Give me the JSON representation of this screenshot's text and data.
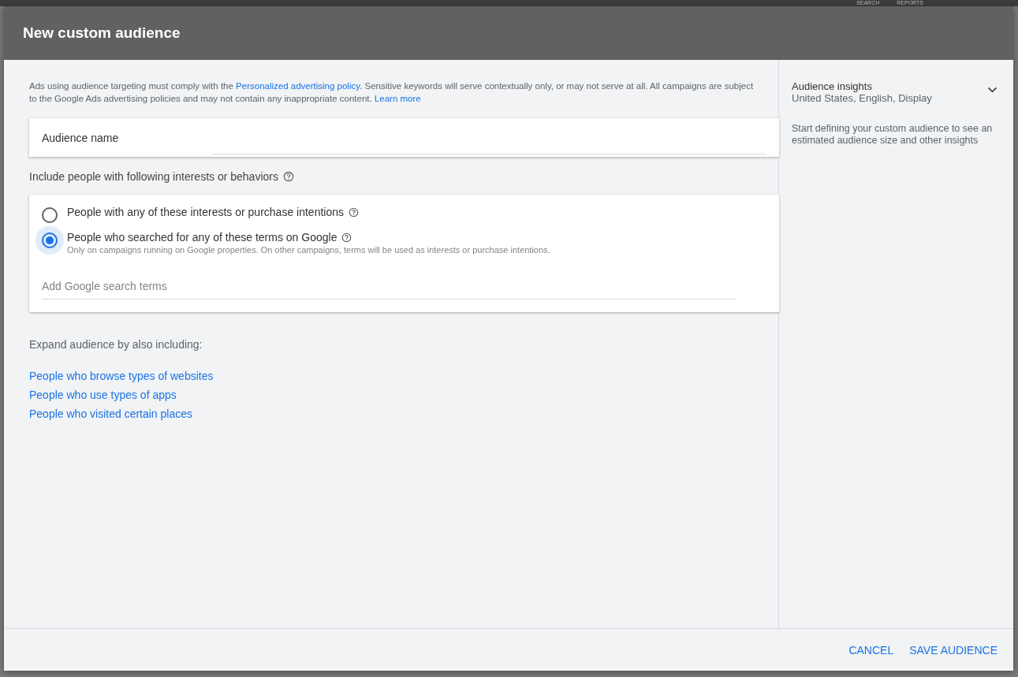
{
  "backdrop": {
    "nav_items": [
      "SEARCH",
      "REPORTS"
    ]
  },
  "dialog": {
    "title": "New custom audience",
    "notice": [
      {
        "kind": "text",
        "text": "Ads using audience targeting must comply with the "
      },
      {
        "kind": "link",
        "text": "Personalized advertising policy"
      },
      {
        "kind": "text",
        "text": ". Sensitive keywords will serve contextually only, or may not serve at all. All campaigns are subject to the Google Ads advertising policies and may not contain any inappropriate content. "
      },
      {
        "kind": "link",
        "text": "Learn more"
      }
    ],
    "name_field": {
      "label": "Audience name"
    },
    "include_label": "Include people with following interests or behaviors",
    "options": [
      {
        "label": "People with any of these interests or purchase intentions",
        "selected": false
      },
      {
        "label": "People who searched for any of these terms on Google",
        "selected": true,
        "hint": "Only on campaigns running on Google properties. On other campaigns, terms will be used as interests or purchase intentions."
      }
    ],
    "terms_field": {
      "placeholder": "Add Google search terms"
    },
    "expand_label": "Expand audience by also including:",
    "expand_links": [
      "People who browse types of websites",
      "People who use types of apps",
      "People who visited certain places"
    ],
    "insights": {
      "title": "Audience insights",
      "subtitle": "United States, English, Display",
      "expanded": false,
      "message": "Start defining your custom audience to see an estimated audience size and other insights"
    },
    "buttons": [
      "CANCEL",
      "SAVE AUDIENCE"
    ]
  }
}
